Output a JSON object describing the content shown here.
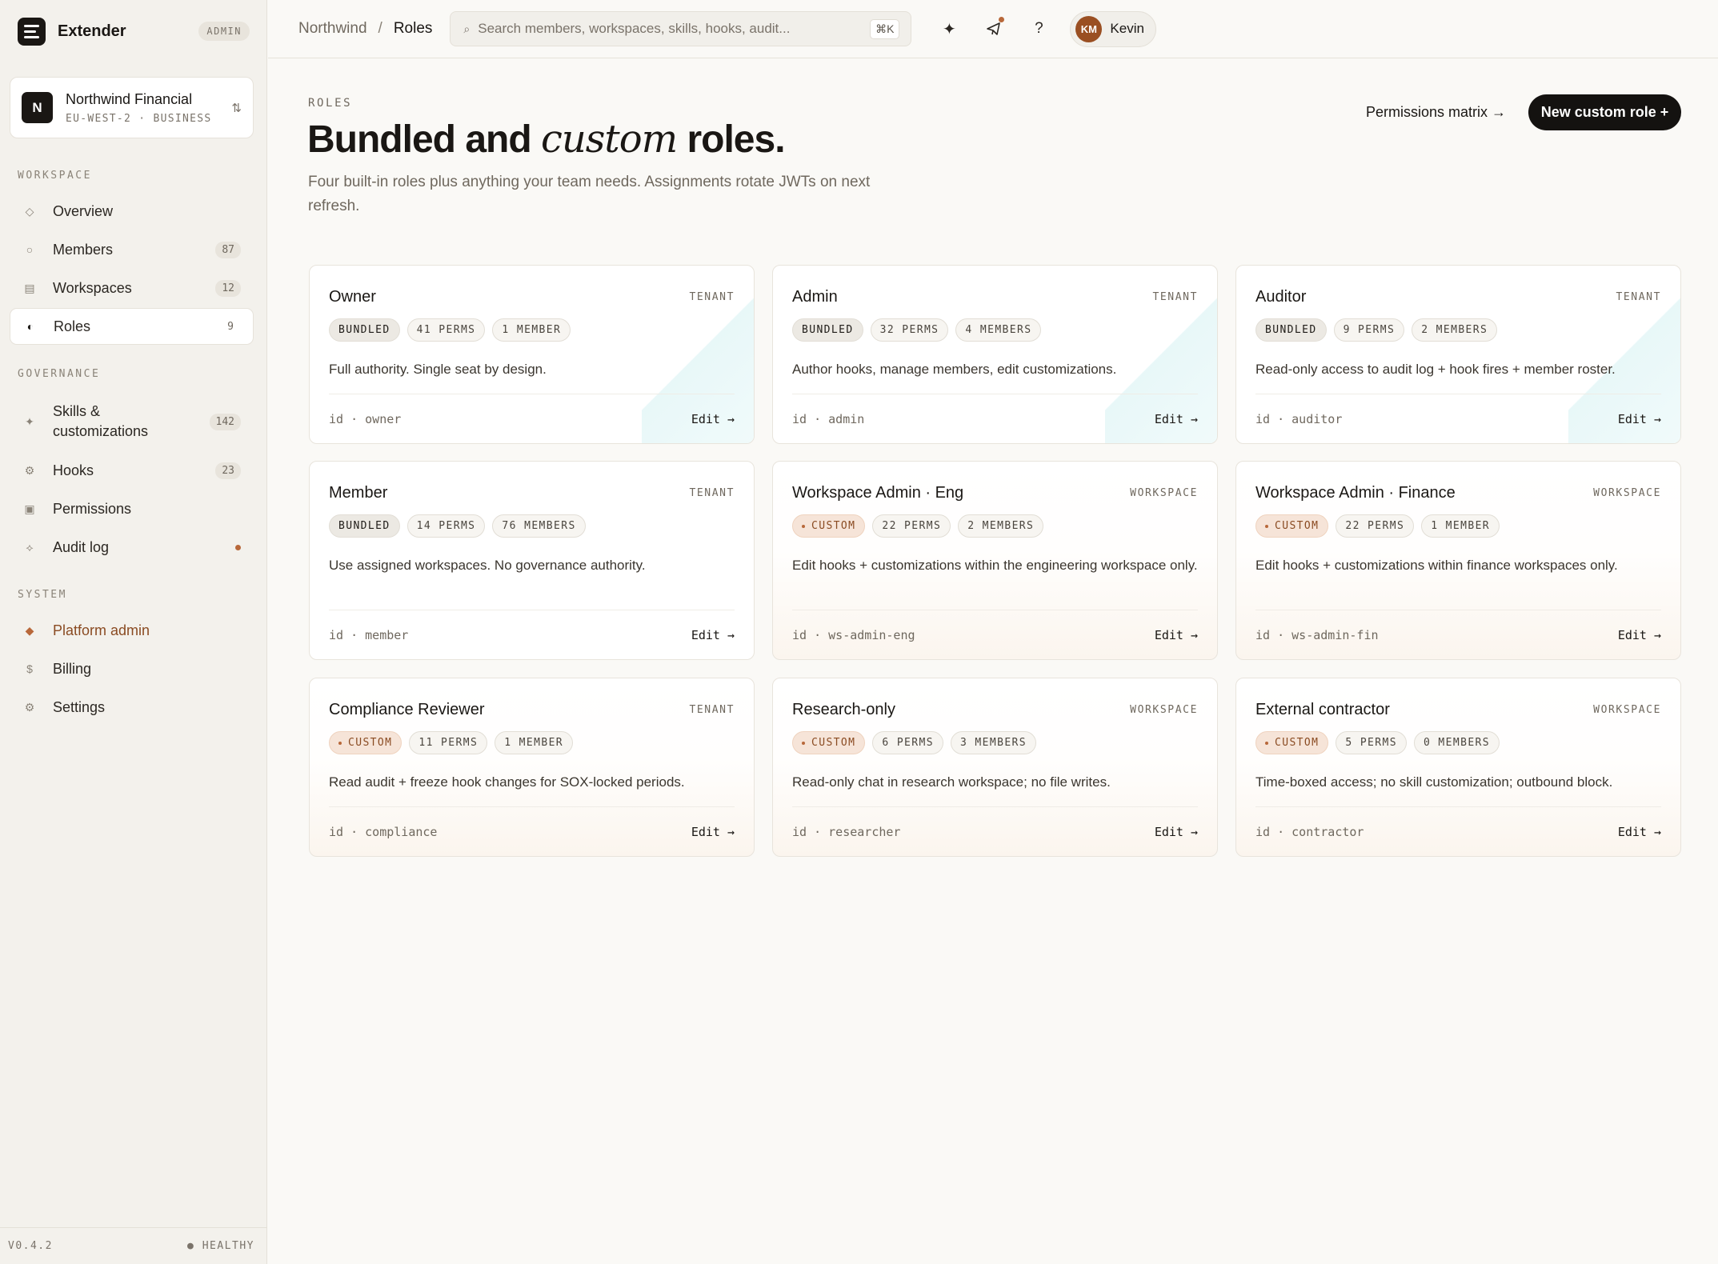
{
  "app": {
    "name": "Extender",
    "badge": "ADMIN"
  },
  "org": {
    "initial": "N",
    "name": "Northwind Financial",
    "meta": "EU-WEST-2 · BUSINESS"
  },
  "nav": {
    "workspace_label": "WORKSPACE",
    "governance_label": "GOVERNANCE",
    "system_label": "SYSTEM",
    "overview": {
      "icon": "◇",
      "label": "Overview"
    },
    "members": {
      "icon": "○",
      "label": "Members",
      "count": "87"
    },
    "workspaces": {
      "icon": "▤",
      "label": "Workspaces",
      "count": "12"
    },
    "roles": {
      "icon": "◐",
      "label": "Roles",
      "count": "9"
    },
    "skills": {
      "icon": "✦",
      "label": "Skills & customizations",
      "count": "142"
    },
    "hooks": {
      "icon": "⚙",
      "label": "Hooks",
      "count": "23"
    },
    "permissions": {
      "icon": "▣",
      "label": "Permissions"
    },
    "audit": {
      "icon": "⟡",
      "label": "Audit log"
    },
    "platform": {
      "icon": "◆",
      "label": "Platform admin"
    },
    "billing": {
      "icon": "$",
      "label": "Billing"
    },
    "settings": {
      "icon": "⚙",
      "label": "Settings"
    }
  },
  "footer": {
    "version": "V0.4.2",
    "status": "● HEALTHY"
  },
  "topbar": {
    "crumb_root": "Northwind",
    "crumb_sep": "/",
    "crumb_current": "Roles",
    "search_placeholder": "Search members, workspaces, skills, hooks, audit...",
    "search_kbd": "⌘K",
    "user_initials": "KM",
    "user_name": "Kevin"
  },
  "page": {
    "eyebrow": "ROLES",
    "title_a": "Bundled and ",
    "title_em": "custom",
    "title_b": " roles.",
    "subtitle": "Four built-in roles plus anything your team needs. Assignments rotate JWTs on next refresh.",
    "permissions_matrix": "Permissions matrix →",
    "new_role": "New custom role +"
  },
  "roles": [
    {
      "name": "Owner",
      "scope": "TENANT",
      "kind": "BUNDLED",
      "perms": "41 PERMS",
      "members": "1 MEMBER",
      "desc": "Full authority. Single seat by design.",
      "id": "id · owner",
      "edit": "Edit →"
    },
    {
      "name": "Admin",
      "scope": "TENANT",
      "kind": "BUNDLED",
      "perms": "32 PERMS",
      "members": "4 MEMBERS",
      "desc": "Author hooks, manage members, edit customizations.",
      "id": "id · admin",
      "edit": "Edit →"
    },
    {
      "name": "Auditor",
      "scope": "TENANT",
      "kind": "BUNDLED",
      "perms": "9 PERMS",
      "members": "2 MEMBERS",
      "desc": "Read-only access to audit log + hook fires + member roster.",
      "id": "id · auditor",
      "edit": "Edit →"
    },
    {
      "name": "Member",
      "scope": "TENANT",
      "kind": "BUNDLED",
      "perms": "14 PERMS",
      "members": "76 MEMBERS",
      "desc": "Use assigned workspaces. No governance authority.",
      "id": "id · member",
      "edit": "Edit →"
    },
    {
      "name": "Workspace Admin · Eng",
      "scope": "WORKSPACE",
      "kind": "CUSTOM",
      "perms": "22 PERMS",
      "members": "2 MEMBERS",
      "desc": "Edit hooks + customizations within the engineering workspace only.",
      "id": "id · ws-admin-eng",
      "edit": "Edit →"
    },
    {
      "name": "Workspace Admin · Finance",
      "scope": "WORKSPACE",
      "kind": "CUSTOM",
      "perms": "22 PERMS",
      "members": "1 MEMBER",
      "desc": "Edit hooks + customizations within finance workspaces only.",
      "id": "id · ws-admin-fin",
      "edit": "Edit →"
    },
    {
      "name": "Compliance Reviewer",
      "scope": "TENANT",
      "kind": "CUSTOM",
      "perms": "11 PERMS",
      "members": "1 MEMBER",
      "desc": "Read audit + freeze hook changes for SOX-locked periods.",
      "id": "id · compliance",
      "edit": "Edit →"
    },
    {
      "name": "Research-only",
      "scope": "WORKSPACE",
      "kind": "CUSTOM",
      "perms": "6 PERMS",
      "members": "3 MEMBERS",
      "desc": "Read-only chat in research workspace; no file writes.",
      "id": "id · researcher",
      "edit": "Edit →"
    },
    {
      "name": "External contractor",
      "scope": "WORKSPACE",
      "kind": "CUSTOM",
      "perms": "5 PERMS",
      "members": "0 MEMBERS",
      "desc": "Time-boxed access; no skill customization; outbound block.",
      "id": "id · contractor",
      "edit": "Edit →"
    }
  ]
}
